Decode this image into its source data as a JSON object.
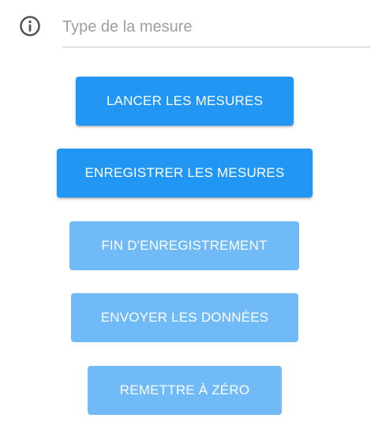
{
  "header": {
    "icon": "info-icon",
    "measure_type_placeholder": "Type de la mesure",
    "measure_type_value": ""
  },
  "buttons": {
    "start_measures": "LANCER LES MESURES",
    "record_measures": "ENREGISTRER LES MESURES",
    "end_recording": "FIN D'ENREGISTREMENT",
    "send_data": "ENVOYER LES DONNÉES",
    "reset": "REMETTRE À ZÉRO"
  },
  "colors": {
    "primary": "#2196f3",
    "primary_disabled": "#6fbaf7",
    "icon": "#555555",
    "underline": "#c4c4c4"
  }
}
